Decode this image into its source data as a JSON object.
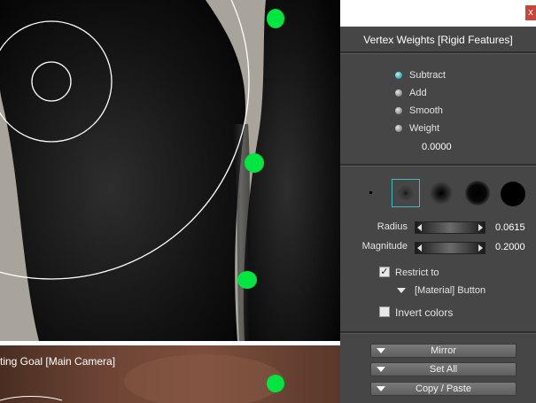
{
  "panel": {
    "title": "Vertex Weights [Rigid Features]",
    "close_label": "x",
    "modes": [
      {
        "label": "Subtract",
        "selected": true
      },
      {
        "label": "Add",
        "selected": false
      },
      {
        "label": "Smooth",
        "selected": false
      },
      {
        "label": "Weight",
        "selected": false
      }
    ],
    "weight_value": "0.0000",
    "brushes": [
      "brush-tiny",
      "brush-small-soft",
      "brush-medium-soft",
      "brush-large-soft",
      "brush-hard"
    ],
    "radius": {
      "label": "Radius",
      "value": "0.0615"
    },
    "magnitude": {
      "label": "Magnitude",
      "value": "0.2000"
    },
    "restrict": {
      "label": "Restrict to",
      "checked": true
    },
    "material": {
      "label": "[Material] Button"
    },
    "invert": {
      "label": "Invert colors",
      "checked": false
    },
    "buttons": {
      "mirror": "Mirror",
      "set_all": "Set All",
      "copy_paste": "Copy / Paste"
    }
  },
  "viewport": {
    "lower_label": "ting Goal [Main Camera]"
  },
  "colors": {
    "accent": "#2aa6b3",
    "marker": "#00e640",
    "panel_bg": "#464646"
  }
}
